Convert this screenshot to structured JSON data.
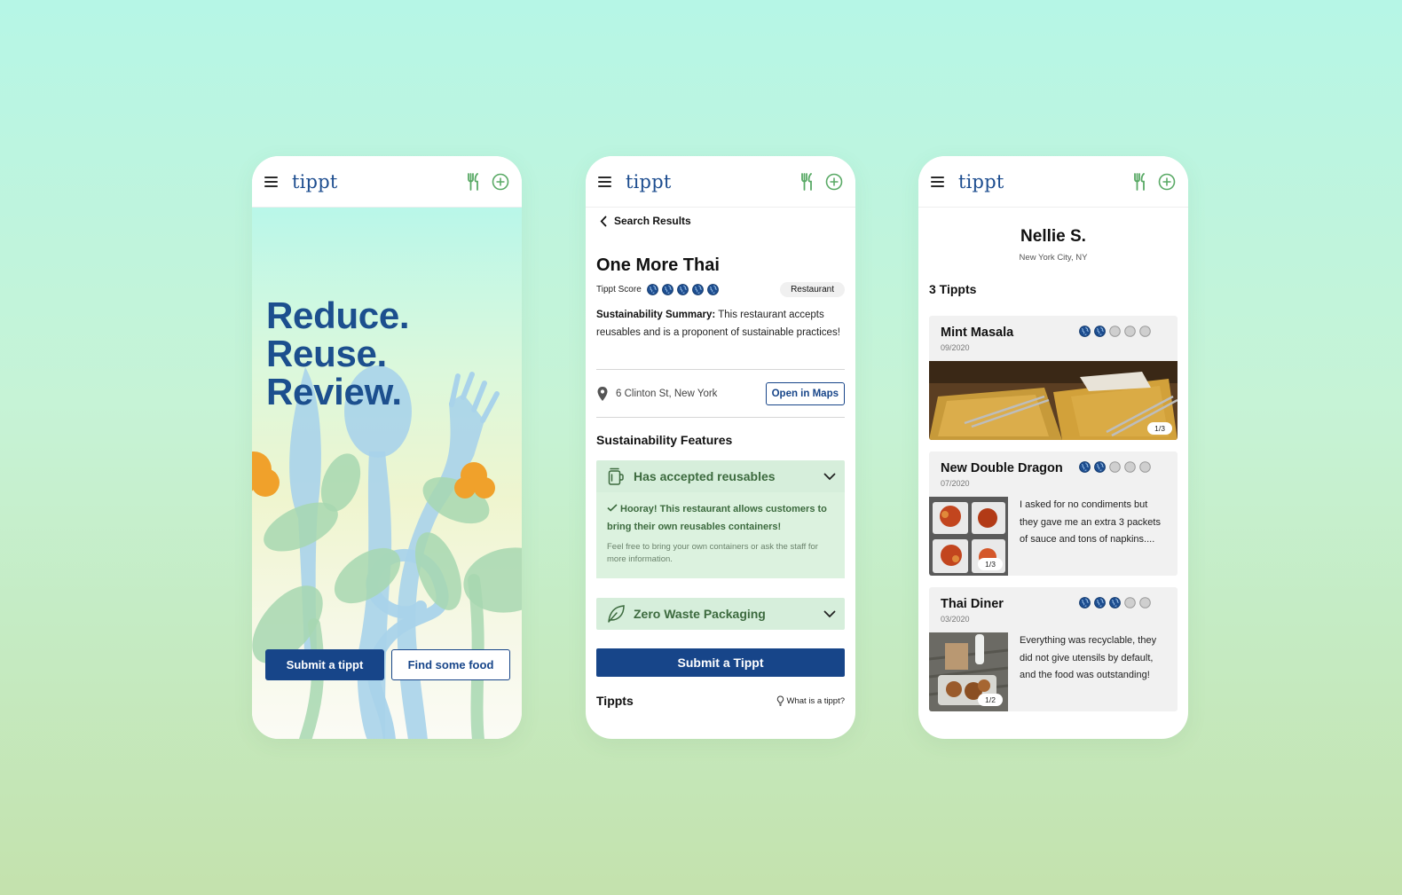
{
  "brand": {
    "logo": "tippt",
    "primary": "#174589",
    "green": "#6db876",
    "accent_green_bg": "#d6eedb"
  },
  "nav_icons": [
    "menu-icon",
    "fork-knife-icon",
    "plus-circle-icon"
  ],
  "landing": {
    "headline": [
      "Reduce.",
      "Reuse.",
      "Review."
    ],
    "submit_button": "Submit a tippt",
    "find_button": "Find some food"
  },
  "restaurant": {
    "back_label": "Search Results",
    "name": "One More Thai",
    "score_label": "Tippt Score",
    "score": 5,
    "score_max": 5,
    "category": "Restaurant",
    "summary_label": "Sustainability Summary:",
    "summary_text": "This restaurant accepts reusables and is a proponent of sustainable practices!",
    "address": "6 Clinton St, New York",
    "maps_button": "Open in Maps",
    "features_title": "Sustainability Features",
    "features": [
      {
        "title": "Has accepted reusables",
        "icon": "jar-icon",
        "expanded": true,
        "detail_strong": "Hooray! This restaurant allows customers to bring their own reusables containers!",
        "detail_small": "Feel free to bring your own containers or ask the staff for more information."
      },
      {
        "title": "Zero Waste Packaging",
        "icon": "leaf-icon",
        "expanded": false
      }
    ],
    "submit_button": "Submit a Tippt",
    "tippts_title": "Tippts",
    "what_link": "What is a tippt?"
  },
  "profile": {
    "name": "Nellie S.",
    "location": "New York City, NY",
    "count_label": "3 Tippts",
    "reviews": [
      {
        "title": "Mint Masala",
        "date": "09/2020",
        "rating": 2,
        "max": 5,
        "photo_badge": "1/3",
        "text": ""
      },
      {
        "title": "New Double Dragon",
        "date": "07/2020",
        "rating": 2,
        "max": 5,
        "photo_badge": "1/3",
        "text": "I asked for no condiments but they gave me an extra 3 packets of sauce and tons of napkins...."
      },
      {
        "title": "Thai Diner",
        "date": "03/2020",
        "rating": 3,
        "max": 5,
        "photo_badge": "1/2",
        "text": "Everything was recyclable, they did not give utensils by default, and the food was outstanding!"
      }
    ]
  }
}
